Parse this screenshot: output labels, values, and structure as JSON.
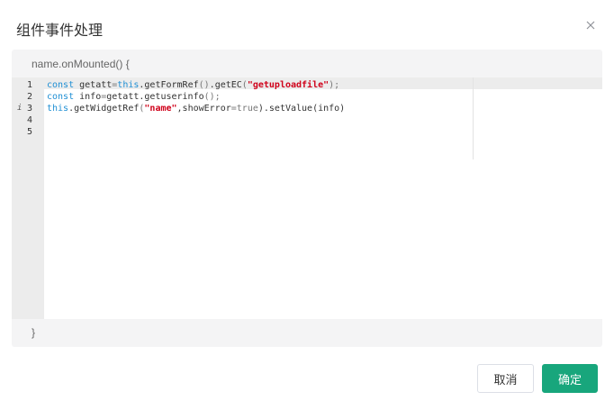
{
  "dialog": {
    "title": "组件事件处理",
    "close_icon": "close-icon"
  },
  "editor": {
    "function_open": "name.onMounted() {",
    "function_close": "}",
    "line_numbers": [
      "1",
      "2",
      "3",
      "4",
      "5"
    ],
    "info_marker": "i",
    "lines": [
      [
        {
          "t": "const",
          "c": "kw"
        },
        {
          "t": " getatt",
          "c": ""
        },
        {
          "t": "=",
          "c": "op"
        },
        {
          "t": "this",
          "c": "kw"
        },
        {
          "t": ".getFormRef",
          "c": ""
        },
        {
          "t": "()",
          "c": "op"
        },
        {
          "t": ".getEC",
          "c": ""
        },
        {
          "t": "(",
          "c": "op"
        },
        {
          "t": "\"getuploadfile\"",
          "c": "str"
        },
        {
          "t": ");",
          "c": "op"
        }
      ],
      [
        {
          "t": "const",
          "c": "kw"
        },
        {
          "t": " info",
          "c": ""
        },
        {
          "t": "=",
          "c": "op"
        },
        {
          "t": "getatt.getuserinfo",
          "c": ""
        },
        {
          "t": "();",
          "c": "op"
        }
      ],
      [
        {
          "t": "this",
          "c": "kw"
        },
        {
          "t": ".getWidgetRef",
          "c": ""
        },
        {
          "t": "(",
          "c": "op"
        },
        {
          "t": "\"name\"",
          "c": "str"
        },
        {
          "t": ",showError",
          "c": ""
        },
        {
          "t": "=",
          "c": "op"
        },
        {
          "t": "true",
          "c": "op"
        },
        {
          "t": ").setValue(info)",
          "c": ""
        }
      ],
      [],
      []
    ]
  },
  "footer": {
    "cancel_label": "取消",
    "ok_label": "确定"
  },
  "colors": {
    "primary": "#18a67c",
    "keyword": "#1f8fd4",
    "string": "#d0021b"
  }
}
